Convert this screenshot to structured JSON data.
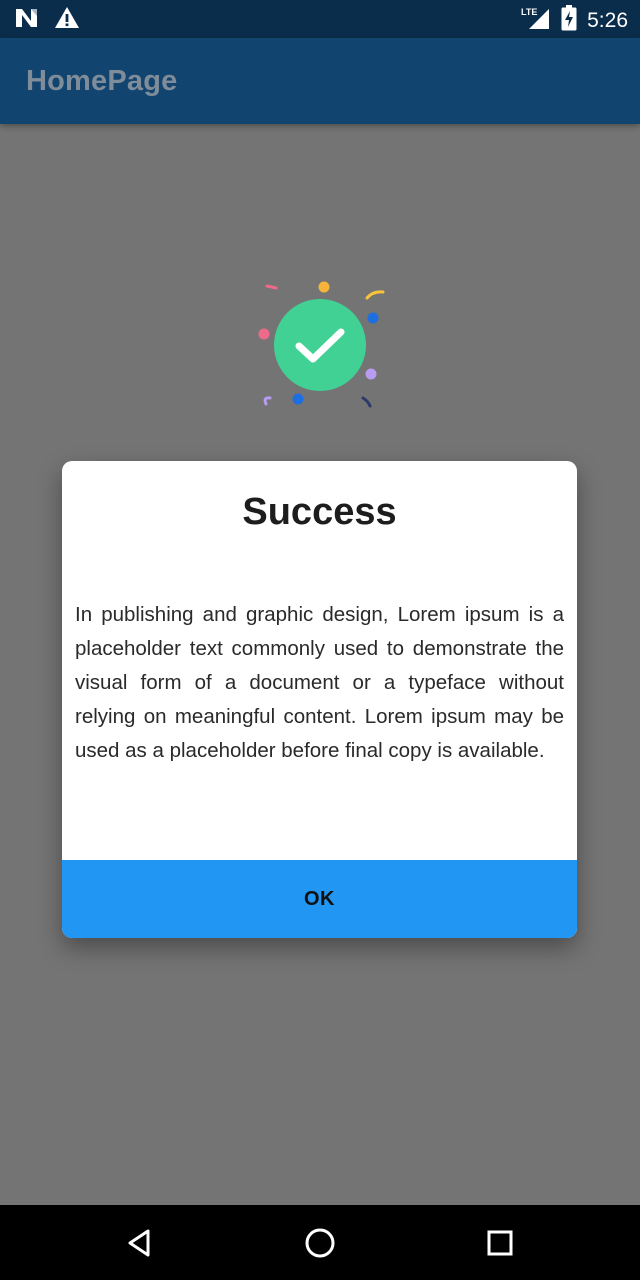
{
  "status_bar": {
    "time": "5:26",
    "network_label": "LTE",
    "icons": [
      "notification-n-icon",
      "warning-icon",
      "lte-signal-icon",
      "battery-charging-icon"
    ]
  },
  "app_bar": {
    "title": "HomePage"
  },
  "success_graphic": {
    "icon": "check-circle-icon",
    "accent_color": "#41d195"
  },
  "dialog": {
    "title": "Success",
    "body": "In publishing and graphic design, Lorem ipsum is a placeholder text commonly used to demonstrate the visual form of a document or a typeface without relying on meaningful content. Lorem ipsum may be used as a placeholder before final copy is available.",
    "ok_label": "OK",
    "button_color": "#2196f3"
  },
  "nav_bar": {
    "buttons": [
      "back-icon",
      "home-icon",
      "recents-icon"
    ]
  },
  "colors": {
    "status_bar": "#0b2d4c",
    "app_bar": "#124470",
    "scrim_background": "#747474"
  }
}
